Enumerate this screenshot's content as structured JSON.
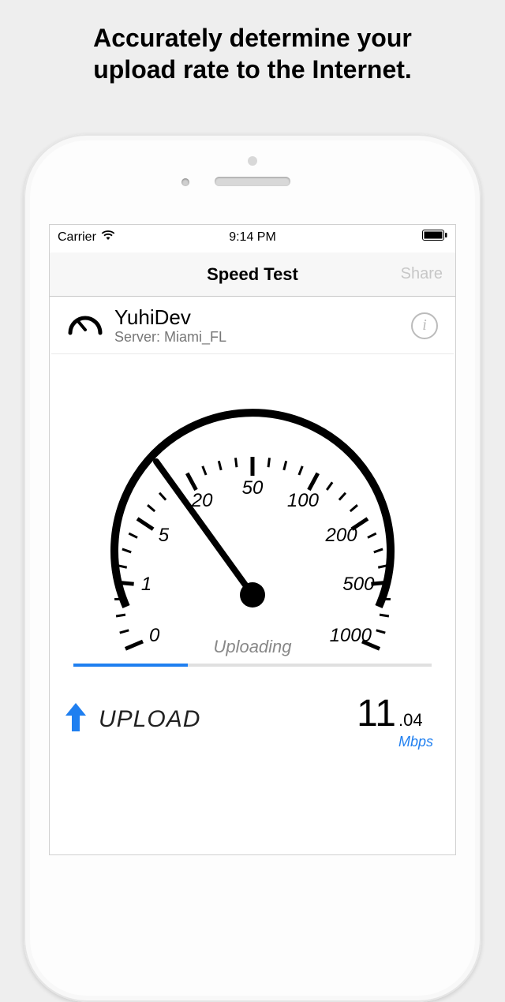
{
  "promo": {
    "line1": "Accurately determine your",
    "line2": "upload rate to the Internet."
  },
  "status": {
    "carrier": "Carrier",
    "time": "9:14 PM"
  },
  "nav": {
    "title": "Speed Test",
    "share": "Share"
  },
  "server": {
    "name": "YuhiDev",
    "subtitle": "Server: Miami_FL"
  },
  "gauge": {
    "ticks": [
      "0",
      "1",
      "5",
      "20",
      "50",
      "100",
      "200",
      "500",
      "1000"
    ],
    "state_label": "Uploading",
    "progress_pct": 32,
    "needle_value_index": 3.1
  },
  "result": {
    "label": "UPLOAD",
    "integer": "11",
    "fraction": ".04",
    "unit": "Mbps"
  },
  "colors": {
    "accent_blue": "#1f7ff0"
  }
}
